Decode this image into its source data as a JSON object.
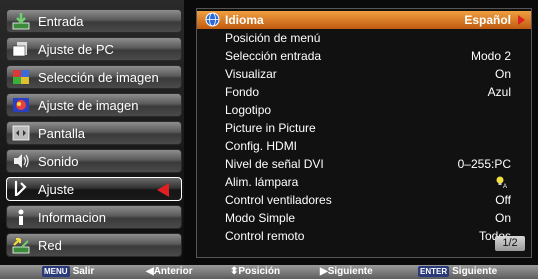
{
  "sidebar": {
    "items": [
      {
        "label": "Entrada",
        "icon": "input-icon"
      },
      {
        "label": "Ajuste de PC",
        "icon": "pc-adjust-icon"
      },
      {
        "label": "Selección de imagen",
        "icon": "image-select-icon"
      },
      {
        "label": "Ajuste de imagen",
        "icon": "image-adjust-icon"
      },
      {
        "label": "Pantalla",
        "icon": "screen-icon"
      },
      {
        "label": "Sonido",
        "icon": "sound-icon"
      },
      {
        "label": "Ajuste",
        "icon": "setting-icon",
        "active": true
      },
      {
        "label": "Informacion",
        "icon": "info-icon"
      },
      {
        "label": "Red",
        "icon": "network-icon"
      }
    ]
  },
  "menu": {
    "rows": [
      {
        "name": "Idioma",
        "value": "Español",
        "selected": true
      },
      {
        "name": "Posición de menú",
        "value": ""
      },
      {
        "name": "Selección entrada",
        "value": "Modo 2"
      },
      {
        "name": "Visualizar",
        "value": "On"
      },
      {
        "name": "Fondo",
        "value": "Azul"
      },
      {
        "name": "Logotipo",
        "value": ""
      },
      {
        "name": "Picture in Picture",
        "value": ""
      },
      {
        "name": "Config. HDMI",
        "value": ""
      },
      {
        "name": "Nivel de señal DVI",
        "value": "0–255:PC"
      },
      {
        "name": "Alim. lámpara",
        "value": "",
        "value_icon": "lamp-eco-icon"
      },
      {
        "name": "Control ventiladores",
        "value": "Off"
      },
      {
        "name": "Modo Simple",
        "value": "On"
      },
      {
        "name": "Control remoto",
        "value": "Todos"
      }
    ],
    "page_indicator": "1/2"
  },
  "footer": {
    "menu_key": "MENU",
    "exit": "Salir",
    "prev": "◀Anterior",
    "position": "⬍Posición",
    "next": "▶Siguiente",
    "enter_key": "ENTER",
    "enter_next": "Siguiente"
  },
  "colors": {
    "highlight": "#e0801e",
    "arrow": "#e02020"
  }
}
